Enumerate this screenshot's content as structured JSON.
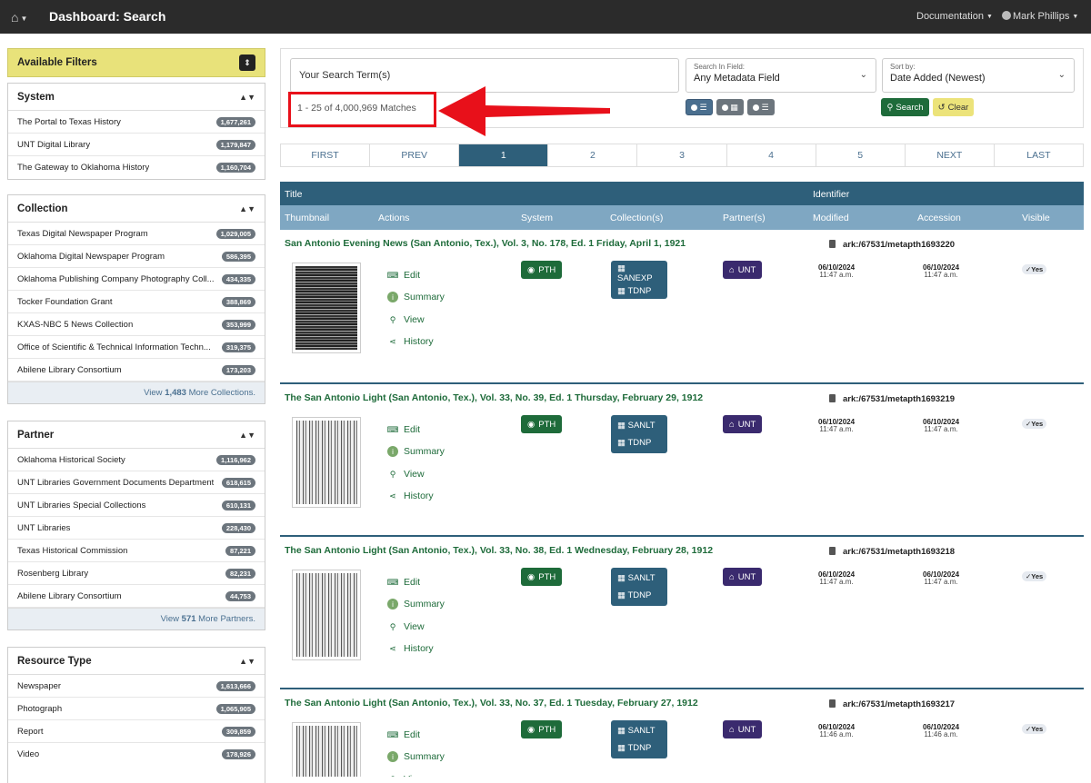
{
  "nav": {
    "title": "Dashboard: Search",
    "docs": "Documentation",
    "user": "Mark Phillips"
  },
  "sidebar": {
    "available_filters": "Available Filters",
    "system": {
      "heading": "System",
      "items": [
        {
          "label": "The Portal to Texas History",
          "count": "1,677,261"
        },
        {
          "label": "UNT Digital Library",
          "count": "1,179,847"
        },
        {
          "label": "The Gateway to Oklahoma History",
          "count": "1,160,704"
        }
      ]
    },
    "collection": {
      "heading": "Collection",
      "items": [
        {
          "label": "Texas Digital Newspaper Program",
          "count": "1,029,005"
        },
        {
          "label": "Oklahoma Digital Newspaper Program",
          "count": "586,395"
        },
        {
          "label": "Oklahoma Publishing Company Photography Coll...",
          "count": "434,335"
        },
        {
          "label": "Tocker Foundation Grant",
          "count": "388,869"
        },
        {
          "label": "KXAS-NBC 5 News Collection",
          "count": "353,999"
        },
        {
          "label": "Office of Scientific & Technical Information Techn...",
          "count": "319,375"
        },
        {
          "label": "Abilene Library Consortium",
          "count": "173,203"
        }
      ],
      "more_prefix": "View",
      "more_count": "1,483",
      "more_suffix": "More Collections."
    },
    "partner": {
      "heading": "Partner",
      "items": [
        {
          "label": "Oklahoma Historical Society",
          "count": "1,116,962"
        },
        {
          "label": "UNT Libraries Government Documents Department",
          "count": "618,615"
        },
        {
          "label": "UNT Libraries Special Collections",
          "count": "610,131"
        },
        {
          "label": "UNT Libraries",
          "count": "228,430"
        },
        {
          "label": "Texas Historical Commission",
          "count": "87,221"
        },
        {
          "label": "Rosenberg Library",
          "count": "82,231"
        },
        {
          "label": "Abilene Library Consortium",
          "count": "44,753"
        }
      ],
      "more_prefix": "View",
      "more_count": "571",
      "more_suffix": "More Partners."
    },
    "resource_type": {
      "heading": "Resource Type",
      "items": [
        {
          "label": "Newspaper",
          "count": "1,613,666"
        },
        {
          "label": "Photograph",
          "count": "1,065,905"
        },
        {
          "label": "Report",
          "count": "309,859"
        },
        {
          "label": "Video",
          "count": "178,926"
        }
      ]
    }
  },
  "search": {
    "term_placeholder": "Your Search Term(s)",
    "field_caption": "Search In Field:",
    "field_value": "Any Metadata Field",
    "sort_caption": "Sort by:",
    "sort_value": "Date Added (Newest)",
    "matches": "1 - 25 of 4,000,969 Matches",
    "search_label": "Search",
    "clear_label": "Clear"
  },
  "pager": [
    "FIRST",
    "PREV",
    "1",
    "2",
    "3",
    "4",
    "5",
    "NEXT",
    "LAST"
  ],
  "table": {
    "header1": {
      "title": "Title",
      "identifier": "Identifier"
    },
    "header2": [
      "Thumbnail",
      "Actions",
      "System",
      "Collection(s)",
      "Partner(s)",
      "Modified",
      "Accession",
      "Visible"
    ]
  },
  "actions": {
    "edit": "Edit",
    "summary": "Summary",
    "view": "View",
    "history": "History"
  },
  "results": [
    {
      "title": "San Antonio Evening News (San Antonio, Tex.), Vol. 3, No. 178, Ed. 1 Friday, April 1, 1921",
      "ark": "ark:/67531/metapth1693220",
      "system": "PTH",
      "collections": [
        "SANEXP",
        "TDNP"
      ],
      "partner": "UNT",
      "modified_date": "06/10/2024",
      "modified_time": "11:47 a.m.",
      "accession_date": "06/10/2024",
      "accession_time": "11:47 a.m.",
      "visible": "Yes"
    },
    {
      "title": "The San Antonio Light (San Antonio, Tex.), Vol. 33, No. 39, Ed. 1 Thursday, February 29, 1912",
      "ark": "ark:/67531/metapth1693219",
      "system": "PTH",
      "collections": [
        "SANLT",
        "TDNP"
      ],
      "partner": "UNT",
      "modified_date": "06/10/2024",
      "modified_time": "11:47 a.m.",
      "accession_date": "06/10/2024",
      "accession_time": "11:47 a.m.",
      "visible": "Yes"
    },
    {
      "title": "The San Antonio Light (San Antonio, Tex.), Vol. 33, No. 38, Ed. 1 Wednesday, February 28, 1912",
      "ark": "ark:/67531/metapth1693218",
      "system": "PTH",
      "collections": [
        "SANLT",
        "TDNP"
      ],
      "partner": "UNT",
      "modified_date": "06/10/2024",
      "modified_time": "11:47 a.m.",
      "accession_date": "06/10/2024",
      "accession_time": "11:47 a.m.",
      "visible": "Yes"
    },
    {
      "title": "The San Antonio Light (San Antonio, Tex.), Vol. 33, No. 37, Ed. 1 Tuesday, February 27, 1912",
      "ark": "ark:/67531/metapth1693217",
      "system": "PTH",
      "collections": [
        "SANLT",
        "TDNP"
      ],
      "partner": "UNT",
      "modified_date": "06/10/2024",
      "modified_time": "11:46 a.m.",
      "accession_date": "06/10/2024",
      "accession_time": "11:46 a.m.",
      "visible": "Yes"
    }
  ],
  "colors": {
    "nav": "#2b2b2b",
    "header": "#2e5f7a",
    "subheader": "#7fa7c2",
    "green": "#1e6b3a",
    "purple": "#3a2a6e",
    "highlight": "#e8101a",
    "filters": "#e8e27a"
  }
}
